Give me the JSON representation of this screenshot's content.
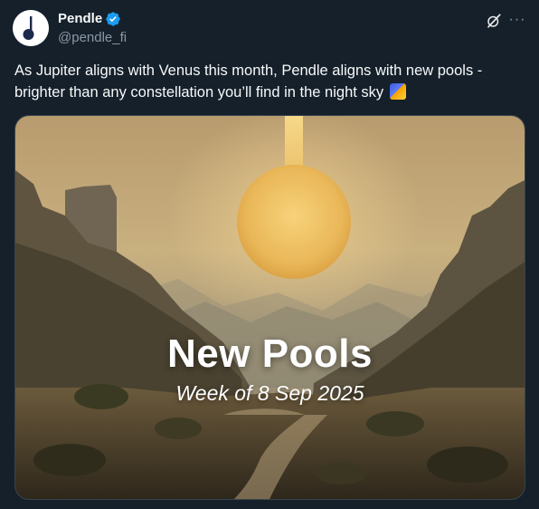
{
  "author": {
    "name": "Pendle",
    "handle": "@pendle_fi",
    "verified": true,
    "avatar_icon": "pendle-logo"
  },
  "actions": {
    "grok_icon": "grok-icon",
    "more_label": "···"
  },
  "tweet": {
    "text": "As Jupiter aligns with Venus this month, Pendle aligns with new pools - brighter than any constellation you’ll find in the night sky",
    "emoji_icon": "shooting-star-emoji"
  },
  "media": {
    "title": "New Pools",
    "subtitle": "Week of 8 Sep 2025"
  },
  "colors": {
    "background": "#15202b",
    "text": "#f7f9f9",
    "secondary_text": "#8b98a5",
    "verified_blue": "#1d9bf0"
  }
}
